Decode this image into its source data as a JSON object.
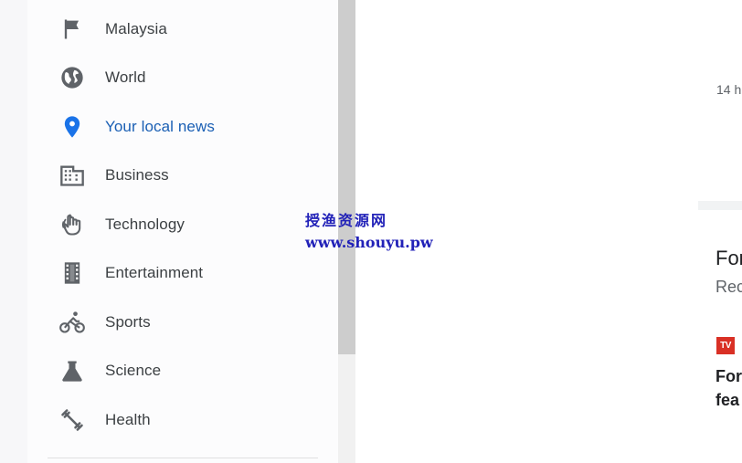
{
  "sidebar": {
    "items": [
      {
        "label": "Malaysia",
        "icon": "flag-icon"
      },
      {
        "label": "World",
        "icon": "globe-icon"
      },
      {
        "label": "Your local news",
        "icon": "location-pin-icon",
        "active": true
      },
      {
        "label": "Business",
        "icon": "building-icon"
      },
      {
        "label": "Technology",
        "icon": "technology-hand-icon"
      },
      {
        "label": "Entertainment",
        "icon": "film-icon"
      },
      {
        "label": "Sports",
        "icon": "bicycle-icon"
      },
      {
        "label": "Science",
        "icon": "flask-icon"
      },
      {
        "label": "Health",
        "icon": "dumbbell-icon"
      }
    ]
  },
  "main": {
    "time": "14 h",
    "card": {
      "title": "For",
      "subtitle": "Rec",
      "source_logo": "TV",
      "headline_line1": "For",
      "headline_line2": "fea"
    }
  },
  "watermark": {
    "line1": "授渔资源网",
    "line2": "www.shouyu.pw"
  },
  "colors": {
    "accent_blue": "#1a73e8",
    "text_primary": "#3c4043",
    "source_logo_red": "#d93025",
    "watermark_blue": "#2222b8"
  }
}
